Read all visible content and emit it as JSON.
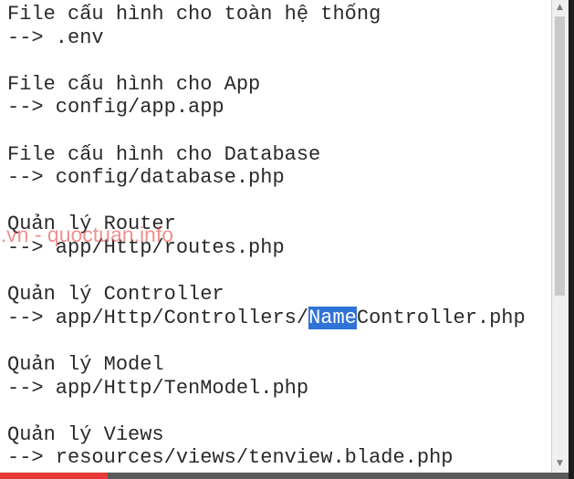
{
  "editor": {
    "lines": [
      {
        "text": "File cấu hình cho toàn hệ thống"
      },
      {
        "text": "--> .env"
      },
      {
        "text": ""
      },
      {
        "text": "File cấu hình cho App"
      },
      {
        "text": "--> config/app.app"
      },
      {
        "text": ""
      },
      {
        "text": "File cấu hình cho Database"
      },
      {
        "text": "--> config/database.php"
      },
      {
        "text": ""
      },
      {
        "text": "Quản lý Router"
      },
      {
        "text": "--> app/Http/routes.php"
      },
      {
        "text": ""
      },
      {
        "text": "Quản lý Controller"
      },
      {
        "before": "--> app/Http/Controllers/",
        "selected": "Name",
        "after": "Controller.php"
      },
      {
        "text": ""
      },
      {
        "text": "Quản lý Model"
      },
      {
        "text": "--> app/Http/TenModel.php"
      },
      {
        "text": ""
      },
      {
        "text": "Quản lý Views"
      },
      {
        "text": "--> resources/views/tenview.blade.php"
      }
    ]
  },
  "watermark": {
    "text": "u.vn - quoctuan.info"
  },
  "scrollbar": {
    "up_icon": "triangle-up",
    "down_icon": "triangle-down"
  },
  "video_progress": {
    "fraction": 0.19,
    "color": "#e53935"
  },
  "colors": {
    "selection": "#2f73d6",
    "text": "#2a2a2a",
    "watermark": "#e13737"
  }
}
